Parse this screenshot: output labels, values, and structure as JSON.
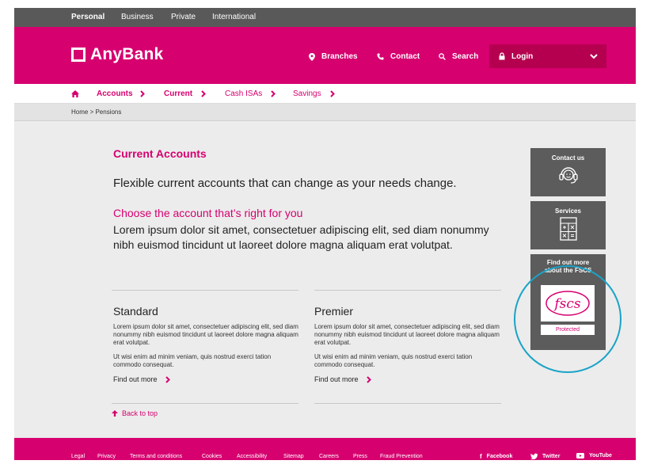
{
  "topnav": {
    "items": [
      {
        "label": "Personal",
        "active": true
      },
      {
        "label": "Business",
        "active": false
      },
      {
        "label": "Private",
        "active": false
      },
      {
        "label": "International",
        "active": false
      }
    ]
  },
  "header": {
    "logo": "AnyBank",
    "branches": "Branches",
    "contact": "Contact",
    "search": "Search",
    "login": "Login"
  },
  "subnav": {
    "items": [
      {
        "label": "Accounts",
        "bold": true
      },
      {
        "label": "Current",
        "bold": true
      },
      {
        "label": "Cash ISAs",
        "bold": false
      },
      {
        "label": "Savings",
        "bold": false
      }
    ]
  },
  "breadcrumb": "Home > Pensions",
  "main": {
    "title": "Current Accounts",
    "lead": "Flexible current accounts that can change as your needs change.",
    "subheading": "Choose the account that’s right for you",
    "body": "Lorem ipsum dolor sit amet, consectetuer adipiscing elit, sed diam nonummy nibh euismod tincidunt ut laoreet dolore magna aliquam erat volutpat."
  },
  "products": [
    {
      "name": "Standard",
      "p1": "Lorem ipsum dolor sit amet, consectetuer adipiscing elit, sed diam nonummy nibh euismod tincidunt ut laoreet dolore magna aliquam erat volutpat.",
      "p2": "Ut wisi enim ad minim veniam, quis nostrud exerci tation commodo consequat.",
      "more": "Find out more"
    },
    {
      "name": "Premier",
      "p1": "Lorem ipsum dolor sit amet, consectetuer adipiscing elit, sed diam nonummy nibh euismod tincidunt ut laoreet dolore magna aliquam erat volutpat.",
      "p2": "Ut wisi enim ad minim veniam, quis nostrud exerci tation commodo consequat.",
      "more": "Find out more"
    }
  ],
  "back_to_top": "Back to top",
  "sidebar": {
    "contact": "Contact us",
    "services": "Services",
    "fscs_line1": "Find out more",
    "fscs_line2": "about the FSCS",
    "fscs_logo": "fscs",
    "fscs_protected": "Protected"
  },
  "footer": {
    "links": [
      "Legal",
      "Privacy",
      "Terms and conditions",
      "Cookies",
      "Accessibility",
      "Sitemap",
      "Careers",
      "Press",
      "Fraud Prevention"
    ],
    "social": [
      "Facebook",
      "Twitter",
      "YouTube"
    ]
  },
  "colors": {
    "brand": "#d6006f",
    "brand_dark": "#b5004f",
    "top_strip": "#595959",
    "tile": "#5c5c5c",
    "highlight_ring": "#1aa3c7"
  },
  "icons": {
    "branches": "map-pin-icon",
    "contact": "phone-icon",
    "search": "search-icon",
    "login": "lock-icon",
    "home": "home-icon",
    "contact_tile": "headset-icon",
    "services_tile": "calculator-icon"
  }
}
